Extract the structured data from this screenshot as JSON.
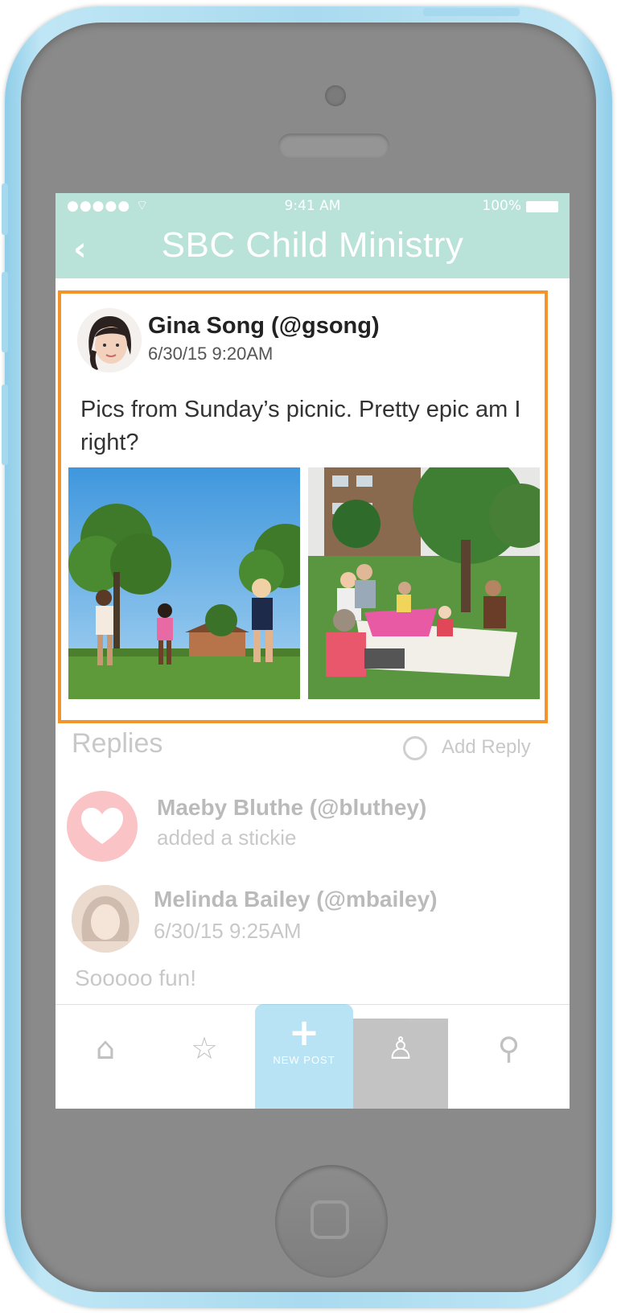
{
  "status_bar": {
    "signal": "●●●●● ⌔",
    "time": "9:41 AM",
    "battery": "100%"
  },
  "header": {
    "title": "SBC Child Ministry",
    "back_icon": "chevron-left-icon"
  },
  "post": {
    "author": "Gina Song (@gsong)",
    "timestamp": "6/30/15  9:20AM",
    "text": "Pics from Sunday’s picnic.  Pretty epic am I right?"
  },
  "replies": {
    "title": "Replies",
    "add_reply_label": "Add Reply",
    "items": [
      {
        "name": "Maeby Bluthe (@bluthey)",
        "subtitle": "added a stickie"
      },
      {
        "name": "Melinda Bailey (@mbailey)",
        "subtitle": "6/30/15  9:25AM",
        "text": "Sooooo fun!"
      }
    ]
  },
  "tabbar": {
    "new_post_label": "NEW POST",
    "icons": [
      "home-icon",
      "star-icon",
      "plus-icon",
      "profile-icon",
      "search-icon"
    ]
  },
  "colors": {
    "header_bg": "#b9e2d8",
    "highlight_border": "#f2942c",
    "new_post_bg": "#62c2e7",
    "heart_bg": "#f56b73"
  }
}
